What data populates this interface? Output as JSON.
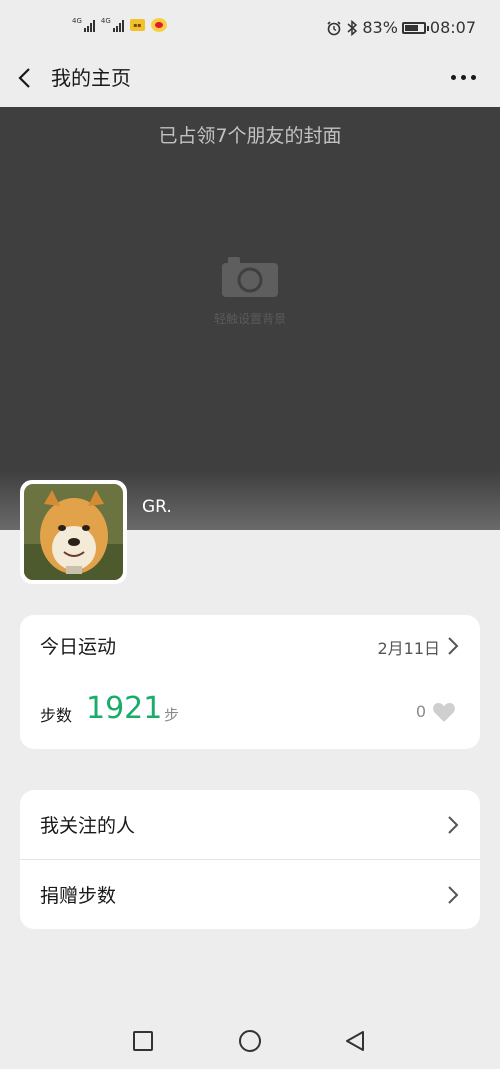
{
  "status_bar": {
    "network_1": "4G",
    "network_2": "4G",
    "battery_level": 0.83,
    "battery_text": "83%",
    "time": "08:07"
  },
  "nav": {
    "title": "我的主页"
  },
  "cover": {
    "caption": "已占领7个朋友的封面",
    "hint": "轻触设置背景"
  },
  "profile": {
    "name": "GR."
  },
  "sport": {
    "today_label": "今日运动",
    "date": "2月11日",
    "steps_label": "步数",
    "steps_value": "1921",
    "steps_unit": "步",
    "likes": "0"
  },
  "menu": {
    "following_label": "我关注的人",
    "donate_label": "捐赠步数"
  },
  "colors": {
    "accent_green": "#1aad6a",
    "cover_bg": "#3f3f3f",
    "page_bg": "#ededed"
  },
  "icons": [
    "back-icon",
    "more-icon",
    "camera-icon",
    "chevron-right-icon",
    "heart-icon",
    "alarm-icon",
    "bluetooth-icon",
    "square-icon",
    "circle-icon",
    "triangle-back-icon"
  ]
}
